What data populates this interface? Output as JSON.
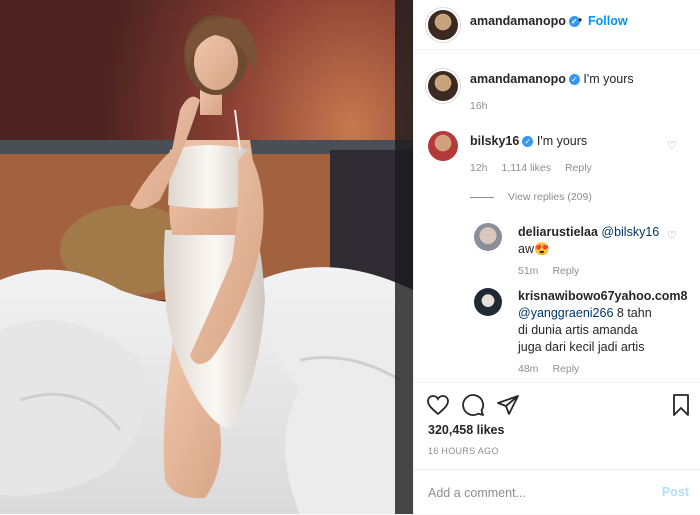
{
  "post": {
    "author": "amandamanopo",
    "follow_label": "Follow",
    "separator": "•"
  },
  "caption": {
    "username": "amandamanopo",
    "text": "I'm yours",
    "time": "16h"
  },
  "comments": [
    {
      "username": "bilsky16",
      "verified": true,
      "text": "I'm yours",
      "time": "12h",
      "likes": "1,114 likes",
      "reply": "Reply",
      "view_replies": "View replies (209)"
    },
    {
      "username": "deliarustielaa",
      "mention": "@bilsky16",
      "text": "aw😍",
      "time": "51m",
      "reply": "Reply"
    },
    {
      "username": "krisnawibowo67yahoo.com8",
      "mention": "@yanggraeni266",
      "text_line1": "8 tahn",
      "text_line2": "di dunia artis amanda",
      "text_line3": "juga dari kecil jadi artis",
      "time": "48m",
      "reply": "Reply"
    }
  ],
  "stats": {
    "likes": "320,458 likes",
    "posted": "16 HOURS AGO"
  },
  "add_comment": {
    "placeholder": "Add a comment...",
    "post_label": "Post"
  },
  "icons": {
    "like": "heart-icon",
    "comment": "comment-icon",
    "share": "paper-plane-icon",
    "save": "bookmark-icon",
    "verified": "verified-badge-icon",
    "more": "more-icon"
  },
  "colors": {
    "accent": "#0095f6",
    "verified": "#3897f0",
    "muted": "#8e8e8e",
    "post_disabled": "#b2dffc"
  }
}
